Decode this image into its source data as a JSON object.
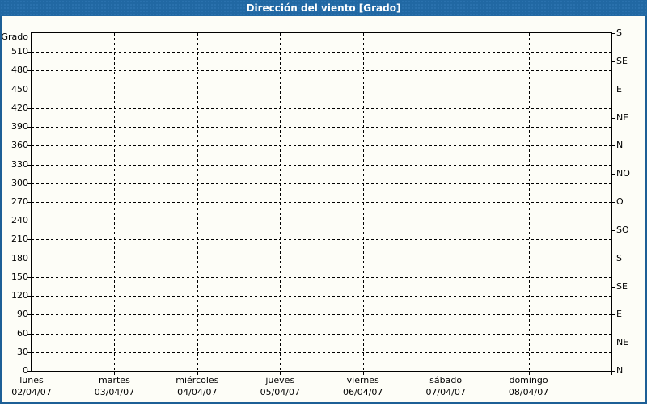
{
  "header": {
    "title": "Dirección del viento [Grado]"
  },
  "chart_data": {
    "type": "line",
    "title": "Dirección del viento [Grado]",
    "series": [],
    "note": "no data plotted - empty grid",
    "y_axis": {
      "label": "Grado",
      "min": 0,
      "max": 540,
      "tick_step": 30,
      "ticks": [
        0,
        30,
        60,
        90,
        120,
        150,
        180,
        210,
        240,
        270,
        300,
        330,
        360,
        390,
        420,
        450,
        480,
        510
      ]
    },
    "y_axis_right": {
      "unit": "compass",
      "ticks": [
        {
          "value": 540,
          "label": "S"
        },
        {
          "value": 495,
          "label": "SE"
        },
        {
          "value": 450,
          "label": "E"
        },
        {
          "value": 405,
          "label": "NE"
        },
        {
          "value": 360,
          "label": "N"
        },
        {
          "value": 315,
          "label": "NO"
        },
        {
          "value": 270,
          "label": "O"
        },
        {
          "value": 225,
          "label": "SO"
        },
        {
          "value": 180,
          "label": "S"
        },
        {
          "value": 135,
          "label": "SE"
        },
        {
          "value": 90,
          "label": "E"
        },
        {
          "value": 45,
          "label": "NE"
        },
        {
          "value": 0,
          "label": "N"
        }
      ]
    },
    "x_axis": {
      "divisions": 7,
      "categories": [
        {
          "day": "lunes",
          "date": "02/04/07"
        },
        {
          "day": "martes",
          "date": "03/04/07"
        },
        {
          "day": "miércoles",
          "date": "04/04/07"
        },
        {
          "day": "jueves",
          "date": "05/04/07"
        },
        {
          "day": "viernes",
          "date": "06/04/07"
        },
        {
          "day": "sábado",
          "date": "07/04/07"
        },
        {
          "day": "domingo",
          "date": "08/04/07"
        }
      ]
    },
    "grid": {
      "style": "dashed",
      "horizontal_step_deg": 30,
      "vertical_per_day": 1,
      "color": "#000000"
    },
    "legend": "none",
    "colors": {
      "titlebar": "#2168A3",
      "titlebar_dot": "#2D74B0",
      "frame_border": "#1D5F96",
      "background": "#FDFDF7",
      "title_text": "#FFFFFF",
      "axis_text": "#000000"
    }
  }
}
